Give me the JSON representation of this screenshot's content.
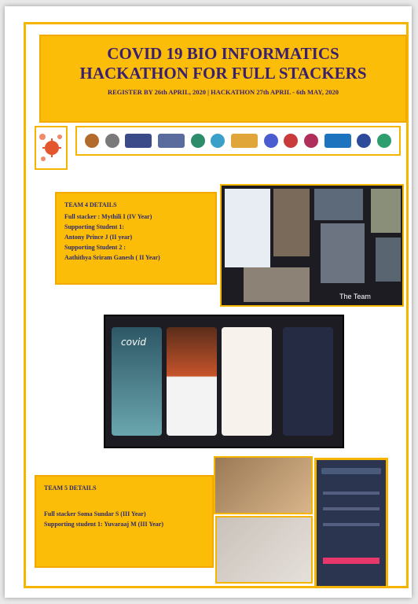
{
  "banner": {
    "title_line1": "COVID 19  BIO INFORMATICS",
    "title_line2": "HACKATHON FOR FULL STACKERS",
    "subtitle": "REGISTER BY 26th APRIL, 2020 | HACKATHON 27th APRIL - 6th MAY, 2020"
  },
  "team4": {
    "title": "TEAM 4 DETAILS",
    "lines": [
      "Full stacker : Mythili I (IV Year)",
      "Supporting Student 1:",
      "Antony Prince J (II year)",
      "Supporting  Student 2 :",
      "Aathithya Sriram Ganesh ( II Year)"
    ]
  },
  "collage": {
    "caption": "The Team"
  },
  "phones": {
    "app_name": "covid"
  },
  "team5": {
    "title": "TEAM 5 DETAILS",
    "lines": [
      "Full stacker  Soma Sundar S (III Year)",
      "Supporting student 1:  Yuvaraaj  M (III Year)"
    ]
  },
  "colors": {
    "accent": "#fbbd08",
    "text": "#3a1f6e"
  }
}
